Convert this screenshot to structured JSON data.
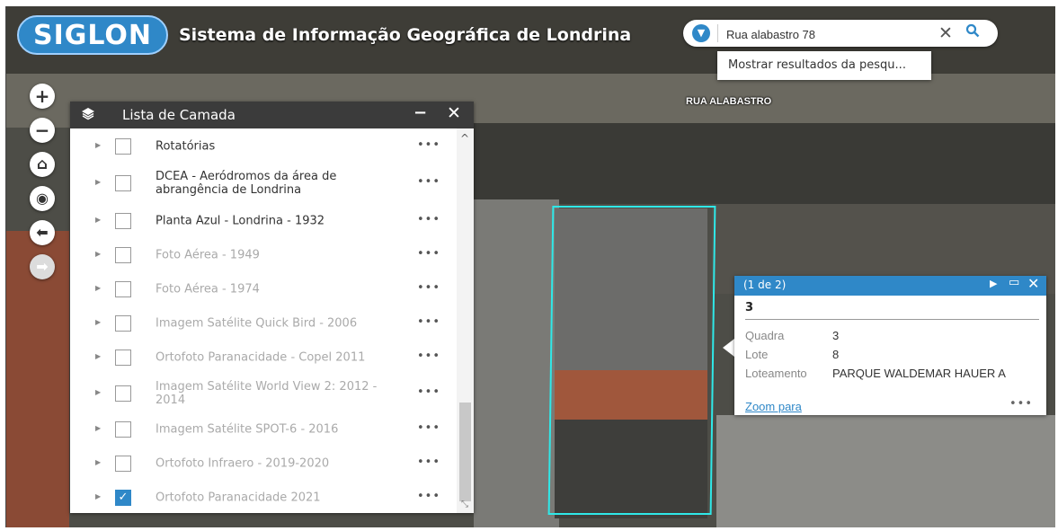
{
  "header": {
    "logo": "SIGLON",
    "title": "Sistema de Informação Geográfica de Londrina"
  },
  "search": {
    "value": "Rua alabastro 78",
    "clear": "✕",
    "dropdown_icon": "caret-down-icon",
    "search_icon": "search-icon",
    "suggestion": "Mostrar resultados da pesqu..."
  },
  "map": {
    "street_label": "RUA ALABASTRO"
  },
  "nav": {
    "zoom_in": "+",
    "zoom_out": "−",
    "home": "⌂",
    "locate": "◉",
    "back": "⬅",
    "forward": "➡"
  },
  "layer_panel": {
    "title": "Lista de Camada",
    "minimize": "−",
    "close": "✕",
    "layers": [
      {
        "label": "Rotatórias",
        "checked": false,
        "dim": false
      },
      {
        "label": "DCEA - Aeródromos da área de abrangência de Londrina",
        "checked": false,
        "dim": false
      },
      {
        "label": "Planta Azul - Londrina - 1932",
        "checked": false,
        "dim": false
      },
      {
        "label": "Foto Aérea - 1949",
        "checked": false,
        "dim": true
      },
      {
        "label": "Foto Aérea - 1974",
        "checked": false,
        "dim": true
      },
      {
        "label": "Imagem Satélite Quick Bird - 2006",
        "checked": false,
        "dim": true
      },
      {
        "label": "Ortofoto Paranacidade - Copel 2011",
        "checked": false,
        "dim": true
      },
      {
        "label": "Imagem Satélite World View 2: 2012 - 2014",
        "checked": false,
        "dim": true
      },
      {
        "label": "Imagem Satélite SPOT-6 - 2016",
        "checked": false,
        "dim": true
      },
      {
        "label": "Ortofoto Infraero - 2019-2020",
        "checked": false,
        "dim": true
      },
      {
        "label": "Ortofoto Paranacidade 2021",
        "checked": true,
        "dim": true
      }
    ],
    "more": "•••"
  },
  "popup": {
    "count": "(1 de 2)",
    "title": "3",
    "fields": [
      {
        "key": "Quadra",
        "value": "3"
      },
      {
        "key": "Lote",
        "value": "8"
      },
      {
        "key": "Loteamento",
        "value": "PARQUE WALDEMAR HAUER A"
      }
    ],
    "zoom_link": "Zoom para",
    "more": "•••"
  },
  "colors": {
    "accent": "#2f88c8",
    "parcel_outline": "#2fe8e8",
    "panel_header": "#3b3b3b"
  }
}
